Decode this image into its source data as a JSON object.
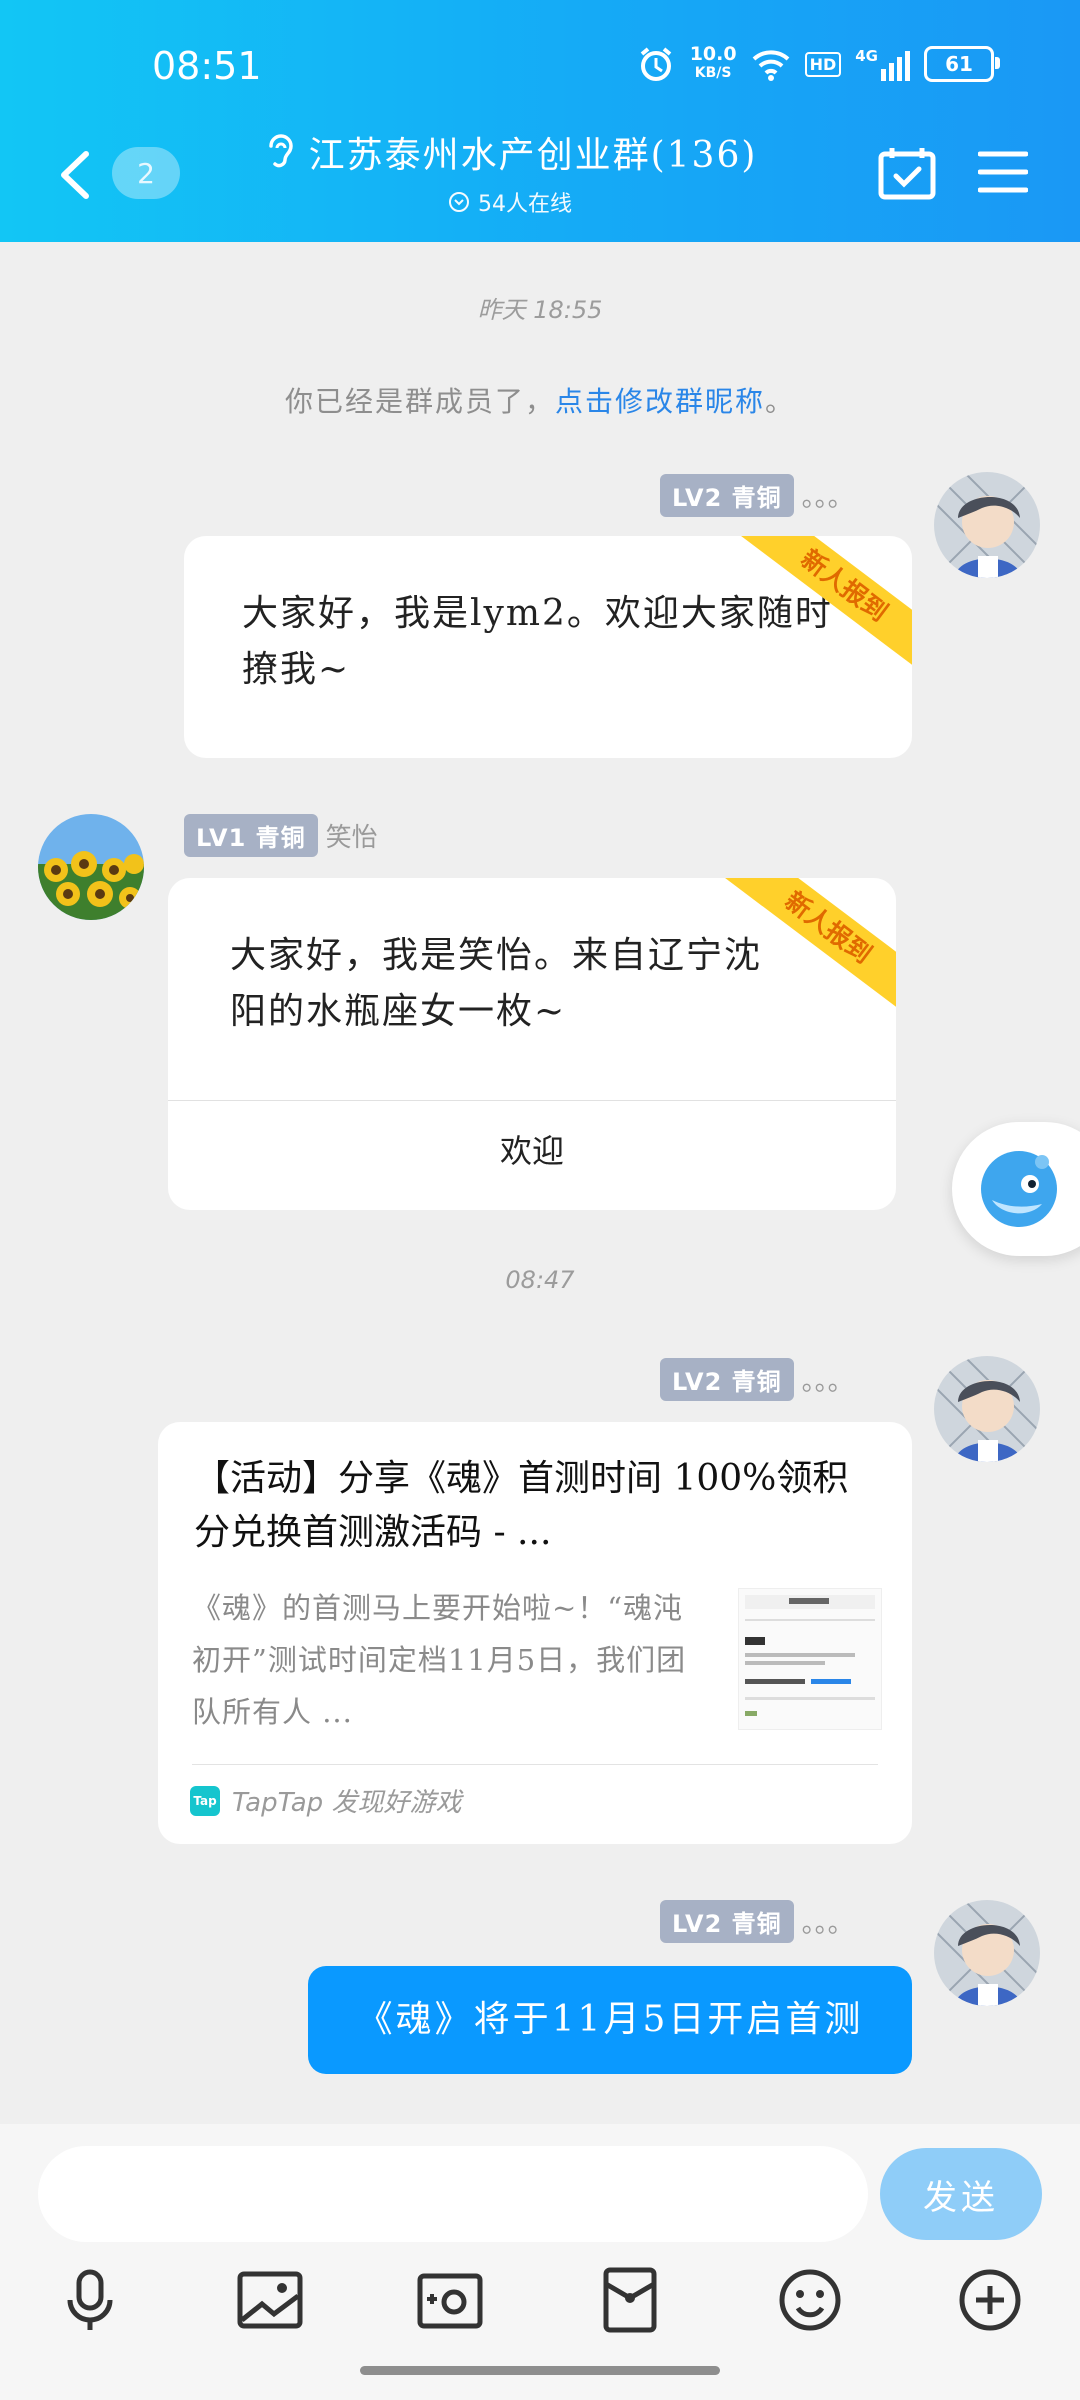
{
  "status_bar": {
    "time": "08:51",
    "net_speed_value": "10.0",
    "net_speed_unit": "KB/S",
    "hd_label": "HD",
    "network_label": "4G",
    "battery": "61"
  },
  "header": {
    "unread_count": "2",
    "group_title": "江苏泰州水产创业群(136)",
    "online_text": "54人在线"
  },
  "chat": {
    "timestamp_1": "昨天 18:55",
    "system_text": "你已经是群成员了，",
    "system_link": "点击修改群昵称",
    "system_end": "。",
    "msg1": {
      "level": "LV2 青铜",
      "nickname": "。。。",
      "text": "大家好，我是lym2。欢迎大家随时撩我~",
      "ribbon": "新人报到"
    },
    "msg2": {
      "level": "LV1 青铜",
      "nickname": "笑怡",
      "text": "大家好，我是笑怡。来自辽宁沈阳的水瓶座女一枚~",
      "ribbon": "新人报到",
      "welcome_label": "欢迎"
    },
    "timestamp_2": "08:47",
    "msg3": {
      "level": "LV2 青铜",
      "nickname": "。。。",
      "title": "【活动】分享《魂》首测时间 100%领积分兑换首测激活码 - ...",
      "desc": "《魂》的首测马上要开始啦~！“魂沌初开”测试时间定档11月5日，我们团队所有人 ...",
      "source_logo": "Tap",
      "source": "TapTap 发现好游戏"
    },
    "msg4": {
      "level": "LV2 青铜",
      "nickname": "。。。",
      "text": "《魂》将于11月5日开启首测"
    }
  },
  "input_bar": {
    "placeholder": "",
    "send_label": "发送"
  },
  "colors": {
    "header_blue": "#15aaf6",
    "bubble_blue": "#0a99ff",
    "ribbon_yellow": "#ffd02b",
    "link_blue": "#2a86e8",
    "level_badge": "#a7b1c5"
  }
}
